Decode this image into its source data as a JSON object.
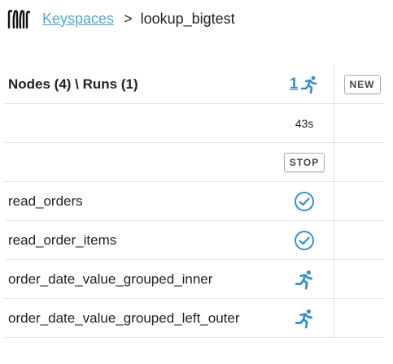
{
  "breadcrumb": {
    "parent_label": "Keyspaces",
    "separator": ">",
    "current_label": "lookup_bigtest"
  },
  "table": {
    "header_label": "Nodes (4) \\ Runs (1)",
    "run_count": "1",
    "new_button_label": "NEW",
    "run_duration": "43s",
    "stop_button_label": "STOP",
    "nodes": [
      {
        "name": "read_orders",
        "status": "complete"
      },
      {
        "name": "read_order_items",
        "status": "complete"
      },
      {
        "name": "order_date_value_grouped_inner",
        "status": "running"
      },
      {
        "name": "order_date_value_grouped_left_outer",
        "status": "running"
      }
    ]
  },
  "colors": {
    "link": "#5aa6c6",
    "accent": "#3b8fc4",
    "border": "#e3e3e3"
  }
}
